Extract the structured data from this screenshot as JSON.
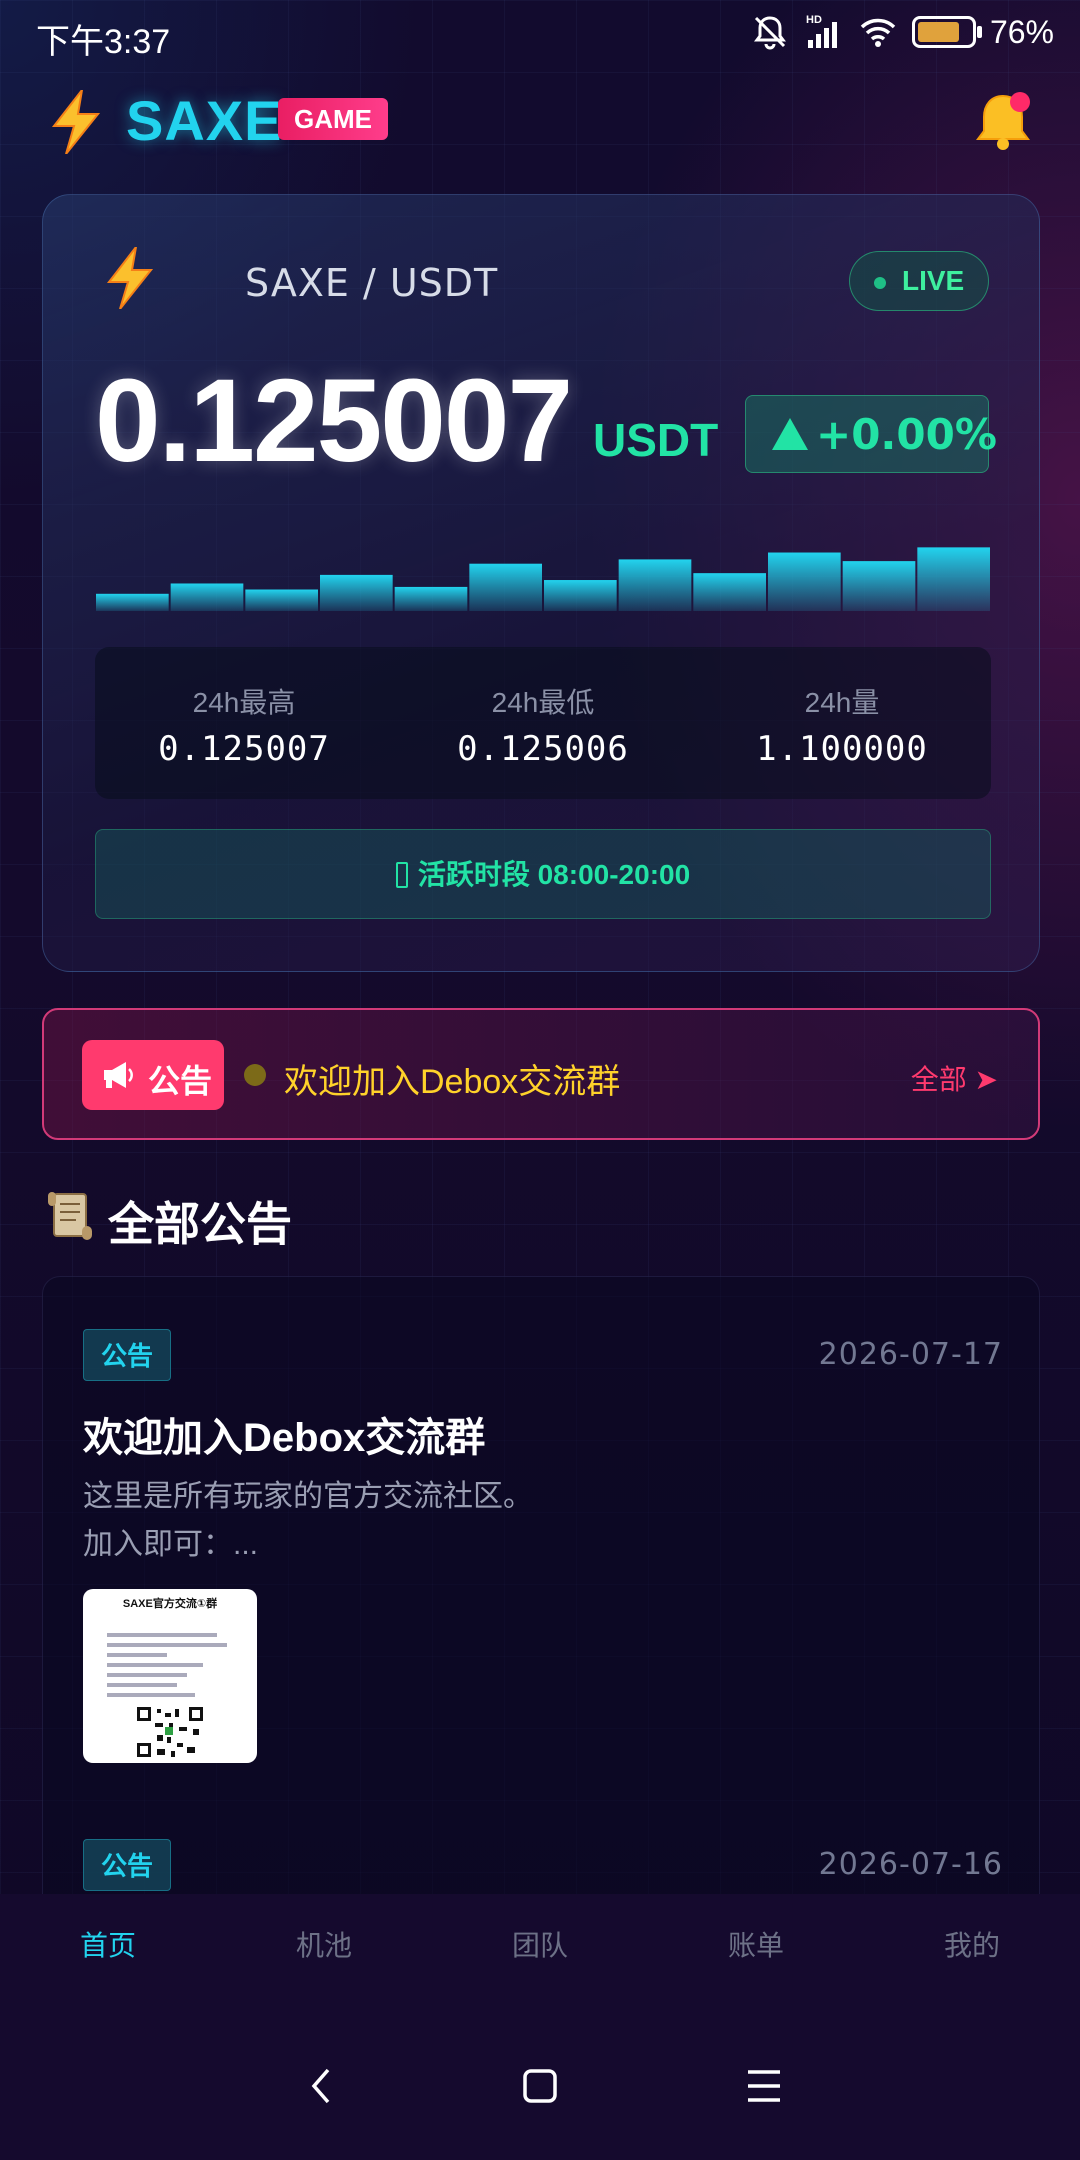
{
  "status_bar": {
    "time": "下午3:37",
    "battery_pct": "76%",
    "battery_level": 0.7
  },
  "header": {
    "app_name": "SAXE",
    "badge": "GAME"
  },
  "price_card": {
    "pair": "SAXE / USDT",
    "live_label": "LIVE",
    "price": "0.125007",
    "unit": "USDT",
    "change": "+0.00%",
    "stats": [
      {
        "label": "24h最高",
        "value": "0.125007"
      },
      {
        "label": "24h最低",
        "value": "0.125006"
      },
      {
        "label": "24h量",
        "value": "1.100000"
      }
    ],
    "active_hours": "活跃时段 08:00-20:00"
  },
  "chart_data": {
    "type": "bar",
    "values": [
      0.2,
      0.32,
      0.25,
      0.42,
      0.28,
      0.55,
      0.36,
      0.6,
      0.44,
      0.68,
      0.58,
      0.74
    ],
    "ylim": [
      0,
      1
    ],
    "color": "#22d3ee"
  },
  "notice": {
    "tag": "公告",
    "message": "欢迎加入Debox交流群",
    "all_label": "全部 ➤"
  },
  "section": {
    "title": "全部公告"
  },
  "announcements": [
    {
      "badge": "公告",
      "date": "2026-07-17",
      "title": "欢迎加入Debox交流群",
      "body_line1": "这里是所有玩家的官方交流社区。",
      "body_line2": "加入即可：...",
      "thumb_title": "SAXE官方交流①群"
    },
    {
      "badge": "公告",
      "date": "2026-07-16"
    }
  ],
  "tabs": [
    {
      "label": "首页",
      "active": true
    },
    {
      "label": "机池"
    },
    {
      "label": "团队"
    },
    {
      "label": "账单"
    },
    {
      "label": "我的"
    }
  ],
  "colors": {
    "accent": "#22d3ee",
    "positive": "#22e3a5",
    "brand_pink": "#ff3a6e",
    "notice_text": "#ffd22a"
  }
}
